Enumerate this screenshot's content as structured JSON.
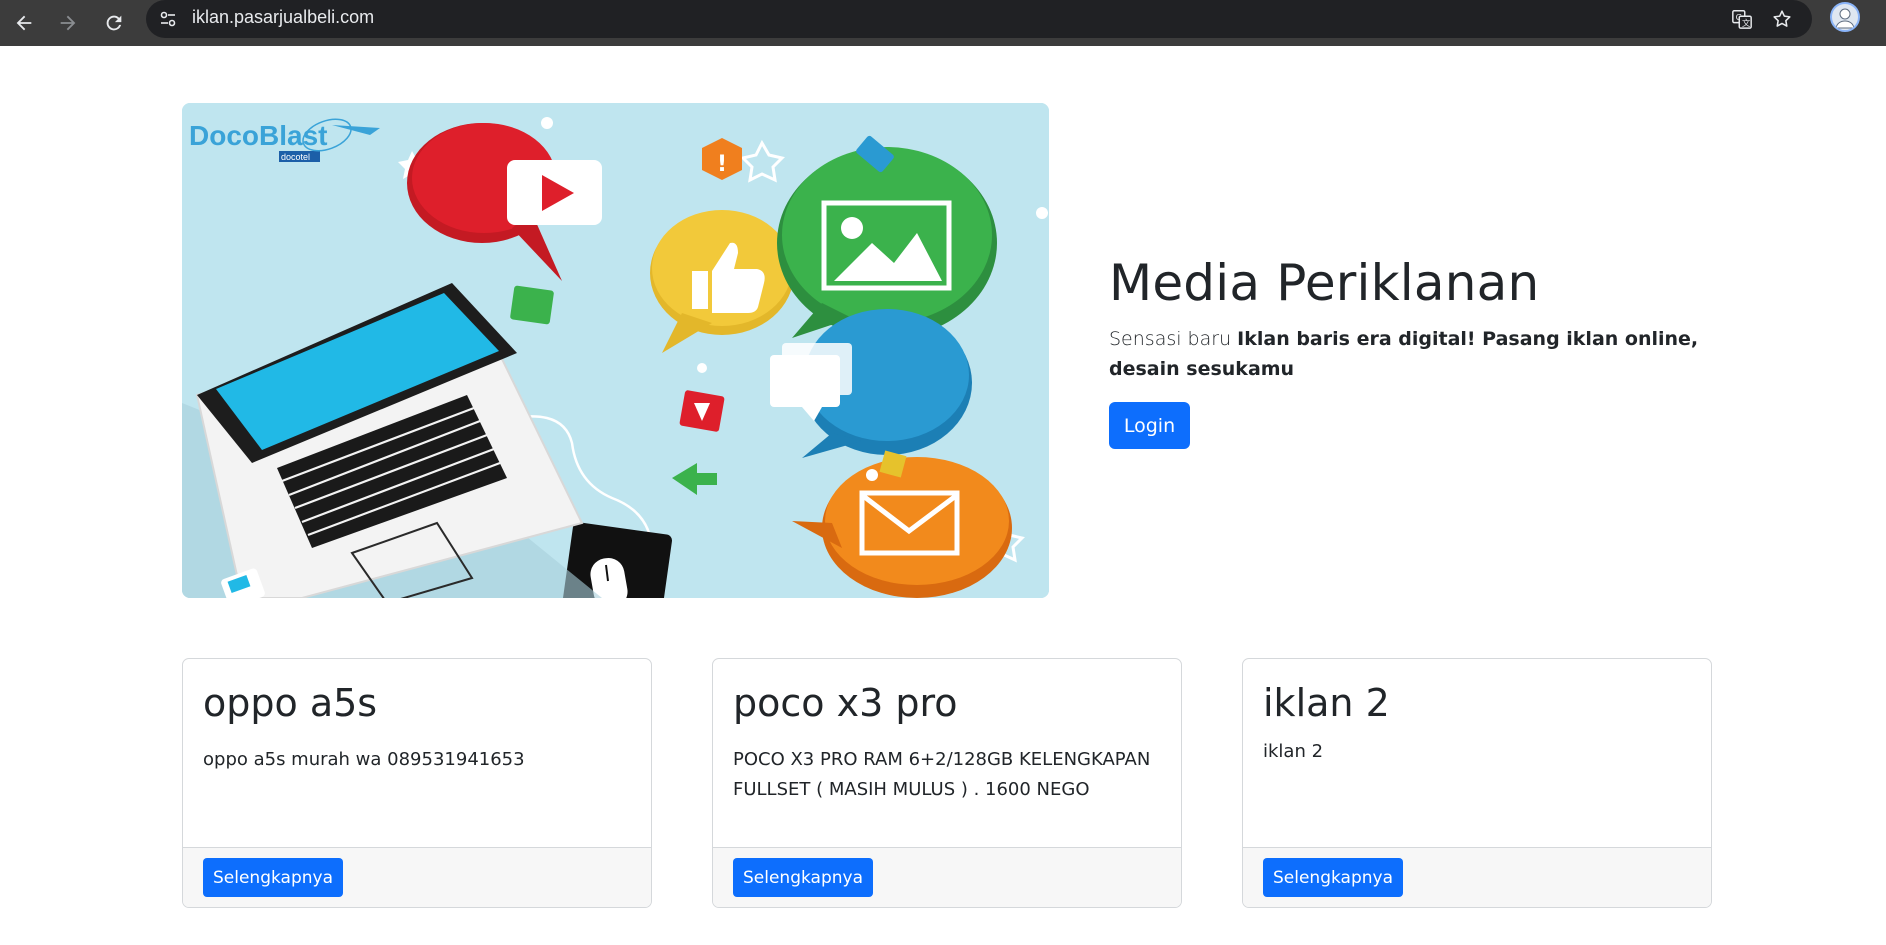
{
  "browser": {
    "url": "iklan.pasarjualbeli.com",
    "icons": [
      "back-icon",
      "forward-icon",
      "reload-icon",
      "site-info-icon",
      "translate-icon",
      "bookmark-star-icon",
      "profile-avatar"
    ]
  },
  "hero": {
    "logo_text": "DocoBlast",
    "logo_sub": "docotel",
    "title": "Media Periklanan",
    "lead_plain": "Sensasi baru ",
    "lead_bold": "Iklan baris era digital! Pasang iklan online, desain sesukamu",
    "login_label": "Login"
  },
  "cards": [
    {
      "title": "oppo a5s",
      "text": "oppo a5s murah wa 089531941653",
      "button": "Selengkapnya"
    },
    {
      "title": "poco x3 pro",
      "text": "POCO X3 PRO RAM 6+2/128GB KELENGKAPAN FULLSET ( MASIH MULUS ) . 1600 NEGO",
      "button": "Selengkapnya"
    },
    {
      "title": "iklan 2",
      "text": "iklan 2",
      "button": "Selengkapnya"
    }
  ],
  "colors": {
    "primary": "#0d6efd",
    "chrome_bg": "#3c3c3c",
    "omnibox_bg": "#202124",
    "hero_bg": "#bfe5ef"
  }
}
